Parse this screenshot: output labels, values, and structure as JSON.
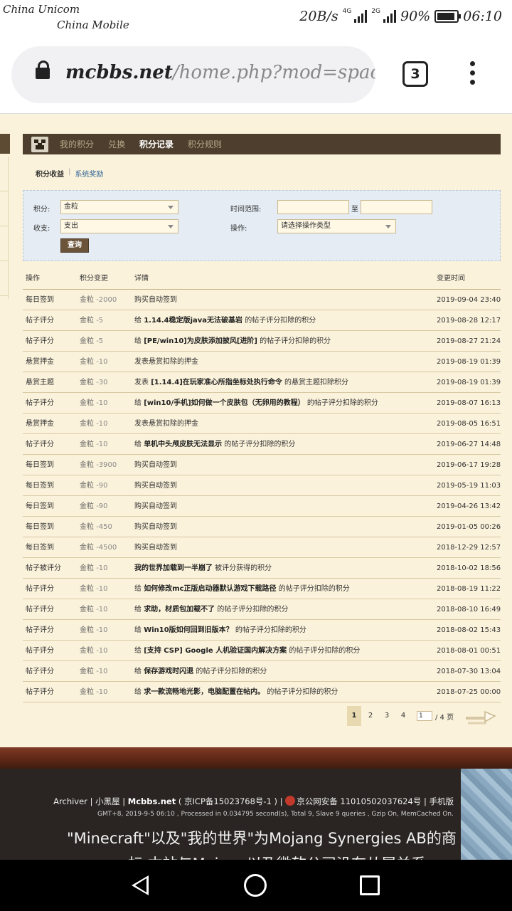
{
  "status_bar": {
    "carrier1": "China Unicom",
    "carrier2": "China Mobile",
    "speed": "20B/s",
    "net1": "4G",
    "net2": "2G",
    "battery": "90%",
    "battery_level": 0.9,
    "time": "06:10"
  },
  "browser": {
    "url_host": "mcbbs.net",
    "url_path": "/home.php?mod=space",
    "tab_count": "3"
  },
  "nav": {
    "items": [
      "我的积分",
      "兑换",
      "积分记录",
      "积分规则"
    ],
    "active": "积分记录"
  },
  "subnav": {
    "current": "积分收益",
    "separator": "|",
    "other": "系统奖励"
  },
  "filter": {
    "points_label": "积分:",
    "points_value": "金粒",
    "direction_label": "收支:",
    "direction_value": "支出",
    "time_range_label": "时间范围:",
    "to_label": "至",
    "operation_label": "操作:",
    "operation_placeholder": "请选择操作类型",
    "query_button": "查询"
  },
  "table": {
    "headers": [
      "操作",
      "积分变更",
      "详情",
      "变更时间"
    ],
    "rows": [
      {
        "op": "每日签到",
        "unit": "金粒",
        "amount": "-2000",
        "pre": "购买自动签到",
        "bold": "",
        "post": "",
        "time": "2019-09-04 23:40"
      },
      {
        "op": "帖子评分",
        "unit": "金粒",
        "amount": "-5",
        "pre": "给 ",
        "bold": "1.14.4稳定版java无法破基岩",
        "post": " 的帖子评分扣除的积分",
        "time": "2019-08-28 12:17"
      },
      {
        "op": "帖子评分",
        "unit": "金粒",
        "amount": "-5",
        "pre": "给 ",
        "bold": "[PE/win10]为皮肤添加披风[进阶]",
        "post": " 的帖子评分扣除的积分",
        "time": "2019-08-27 21:24"
      },
      {
        "op": "悬赏押金",
        "unit": "金粒",
        "amount": "-10",
        "pre": "发表悬赏扣除的押金",
        "bold": "",
        "post": "",
        "time": "2019-08-19 01:39"
      },
      {
        "op": "悬赏主题",
        "unit": "金粒",
        "amount": "-30",
        "pre": "发表 ",
        "bold": "[1.14.4]在玩家准心所指坐标处执行命令",
        "post": " 的悬赏主题扣除积分",
        "time": "2019-08-19 01:39"
      },
      {
        "op": "帖子评分",
        "unit": "金粒",
        "amount": "-10",
        "pre": "给 ",
        "bold": "[win10/手机]如何做一个皮肤包（无卵用的教程）",
        "post": " 的帖子评分扣除的积分",
        "time": "2019-08-07 16:13"
      },
      {
        "op": "悬赏押金",
        "unit": "金粒",
        "amount": "-10",
        "pre": "发表悬赏扣除的押金",
        "bold": "",
        "post": "",
        "time": "2019-08-05 16:51"
      },
      {
        "op": "帖子评分",
        "unit": "金粒",
        "amount": "-10",
        "pre": "给 ",
        "bold": "单机中头颅皮肤无法显示",
        "post": " 的帖子评分扣除的积分",
        "time": "2019-06-27 14:48"
      },
      {
        "op": "每日签到",
        "unit": "金粒",
        "amount": "-3900",
        "pre": "购买自动签到",
        "bold": "",
        "post": "",
        "time": "2019-06-17 19:28"
      },
      {
        "op": "每日签到",
        "unit": "金粒",
        "amount": "-90",
        "pre": "购买自动签到",
        "bold": "",
        "post": "",
        "time": "2019-05-19 11:03"
      },
      {
        "op": "每日签到",
        "unit": "金粒",
        "amount": "-90",
        "pre": "购买自动签到",
        "bold": "",
        "post": "",
        "time": "2019-04-26 13:42"
      },
      {
        "op": "每日签到",
        "unit": "金粒",
        "amount": "-450",
        "pre": "购买自动签到",
        "bold": "",
        "post": "",
        "time": "2019-01-05 00:26"
      },
      {
        "op": "每日签到",
        "unit": "金粒",
        "amount": "-4500",
        "pre": "购买自动签到",
        "bold": "",
        "post": "",
        "time": "2018-12-29 12:57"
      },
      {
        "op": "帖子被评分",
        "unit": "金粒",
        "amount": "-10",
        "pre": "",
        "bold": "我的世界加载到一半崩了",
        "post": " 被评分获得的积分",
        "time": "2018-10-02 18:56"
      },
      {
        "op": "帖子评分",
        "unit": "金粒",
        "amount": "-10",
        "pre": "给 ",
        "bold": "如何修改mc正版启动器默认游戏下载路径",
        "post": " 的帖子评分扣除的积分",
        "time": "2018-08-19 11:22"
      },
      {
        "op": "帖子评分",
        "unit": "金粒",
        "amount": "-10",
        "pre": "给 ",
        "bold": "求助，材质包加载不了",
        "post": " 的帖子评分扣除的积分",
        "time": "2018-08-10 16:49"
      },
      {
        "op": "帖子评分",
        "unit": "金粒",
        "amount": "-10",
        "pre": "给 ",
        "bold": "Win10版如何回到旧版本？",
        "post": " 的帖子评分扣除的积分",
        "time": "2018-08-02 15:43"
      },
      {
        "op": "帖子评分",
        "unit": "金粒",
        "amount": "-10",
        "pre": "给 ",
        "bold": "[支持 CSP] Google 人机验证国内解决方案",
        "post": " 的帖子评分扣除的积分",
        "time": "2018-08-01 00:51"
      },
      {
        "op": "帖子评分",
        "unit": "金粒",
        "amount": "-10",
        "pre": "给 ",
        "bold": "保存游戏时闪退",
        "post": " 的帖子评分扣除的积分",
        "time": "2018-07-30 13:04"
      },
      {
        "op": "帖子评分",
        "unit": "金粒",
        "amount": "-10",
        "pre": "给 ",
        "bold": "求一款流畅地光影，电脑配置在帖内。",
        "post": " 的帖子评分扣除的积分",
        "time": "2018-07-25 00:00"
      }
    ]
  },
  "pager": {
    "pages": [
      "1",
      "2",
      "3",
      "4"
    ],
    "current": "1",
    "input_value": "1",
    "total": "/ 4 页"
  },
  "footer": {
    "archiver": "Archiver",
    "sep": "|",
    "blackroom": "小黑屋",
    "site": "Mcbbs.net",
    "icp": "( 京ICP备15023768号-1 )",
    "police": "京公网安备 11010502037624号",
    "mobile": "手机版",
    "stats": "GMT+8, 2019-9-5 06:10 , Processed in 0.034795 second(s), Total 9, Slave 9 queries , Gzip On, MemCached On.",
    "disclaimer1": "\"Minecraft\"以及\"我的世界\"为Mojang Synergies AB的商",
    "disclaimer2": "标 本站与Mojang以及微软公司没有从属关系"
  }
}
